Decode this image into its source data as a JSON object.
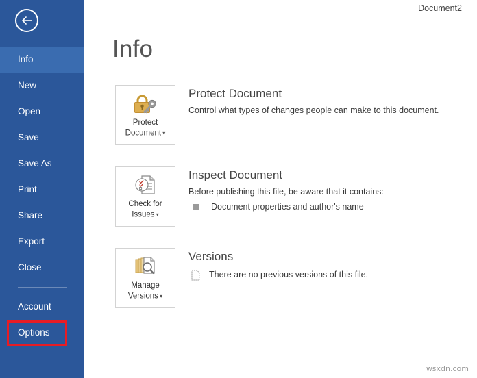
{
  "window": {
    "document_title": "Document2",
    "watermark": "wsxdn.com"
  },
  "colors": {
    "sidebar_bg": "#2b579a",
    "sidebar_selected": "#3a6cb0",
    "highlight_outline": "#e81c24",
    "lock_gold": "#d9a441",
    "key_gray": "#8c8c8c",
    "heading_gray": "#444444"
  },
  "sidebar": {
    "back_button": {
      "name": "back-arrow",
      "icon": "arrow-left-icon"
    },
    "items": [
      {
        "label": "Info",
        "selected": true,
        "highlighted": false
      },
      {
        "label": "New",
        "selected": false,
        "highlighted": false
      },
      {
        "label": "Open",
        "selected": false,
        "highlighted": false
      },
      {
        "label": "Save",
        "selected": false,
        "highlighted": false
      },
      {
        "label": "Save As",
        "selected": false,
        "highlighted": false
      },
      {
        "label": "Print",
        "selected": false,
        "highlighted": false
      },
      {
        "label": "Share",
        "selected": false,
        "highlighted": false
      },
      {
        "label": "Export",
        "selected": false,
        "highlighted": false
      },
      {
        "label": "Close",
        "selected": false,
        "highlighted": false
      },
      {
        "label": "Account",
        "selected": false,
        "highlighted": false
      },
      {
        "label": "Options",
        "selected": false,
        "highlighted": true
      }
    ]
  },
  "main": {
    "page_title": "Info",
    "sections": [
      {
        "id": "protect-document",
        "tile": {
          "icon": "lock-and-key-icon",
          "label_line1": "Protect",
          "label_line2": "Document",
          "has_dropdown": true
        },
        "heading": "Protect Document",
        "description": "Control what types of changes people can make to this document.",
        "bullets": []
      },
      {
        "id": "inspect-document",
        "tile": {
          "icon": "check-document-icon",
          "label_line1": "Check for",
          "label_line2": "Issues",
          "has_dropdown": true
        },
        "heading": "Inspect Document",
        "description": "Before publishing this file, be aware that it contains:",
        "bullets": [
          {
            "icon": "square-bullet-icon",
            "text": "Document properties and author's name"
          }
        ]
      },
      {
        "id": "versions",
        "tile": {
          "icon": "manage-versions-icon",
          "label_line1": "Manage",
          "label_line2": "Versions",
          "has_dropdown": true
        },
        "heading": "Versions",
        "description": "",
        "bullets": [
          {
            "icon": "dotted-document-icon",
            "text": "There are no previous versions of this file."
          }
        ]
      }
    ]
  }
}
